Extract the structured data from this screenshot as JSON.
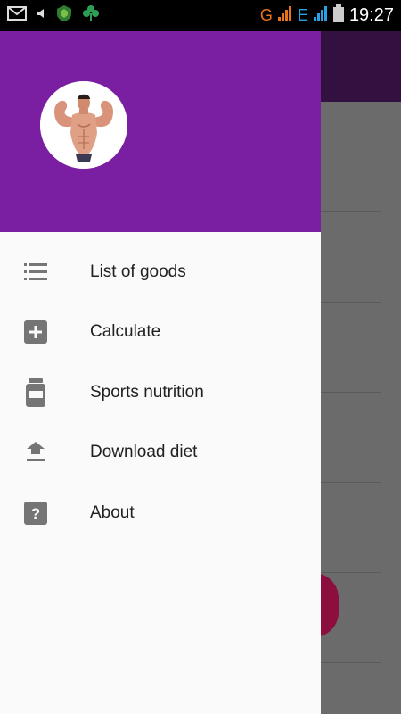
{
  "status_bar": {
    "time": "19:27",
    "network_g": "G",
    "network_e": "E",
    "icons": [
      "gmail-icon",
      "volume-icon",
      "shield-icon",
      "clover-icon",
      "signal-icon",
      "battery-icon"
    ]
  },
  "drawer": {
    "header_color": "#7b1fa2",
    "avatar_icon": "bodybuilder-avatar",
    "items": [
      {
        "label": "List of goods",
        "icon": "list-icon"
      },
      {
        "label": "Calculate",
        "icon": "plus-box-icon"
      },
      {
        "label": "Sports nutrition",
        "icon": "jar-icon"
      },
      {
        "label": "Download diet",
        "icon": "upload-icon"
      },
      {
        "label": "About",
        "icon": "help-box-icon"
      }
    ]
  },
  "colors": {
    "accent": "#7b1fa2",
    "fab": "#e91e63"
  }
}
